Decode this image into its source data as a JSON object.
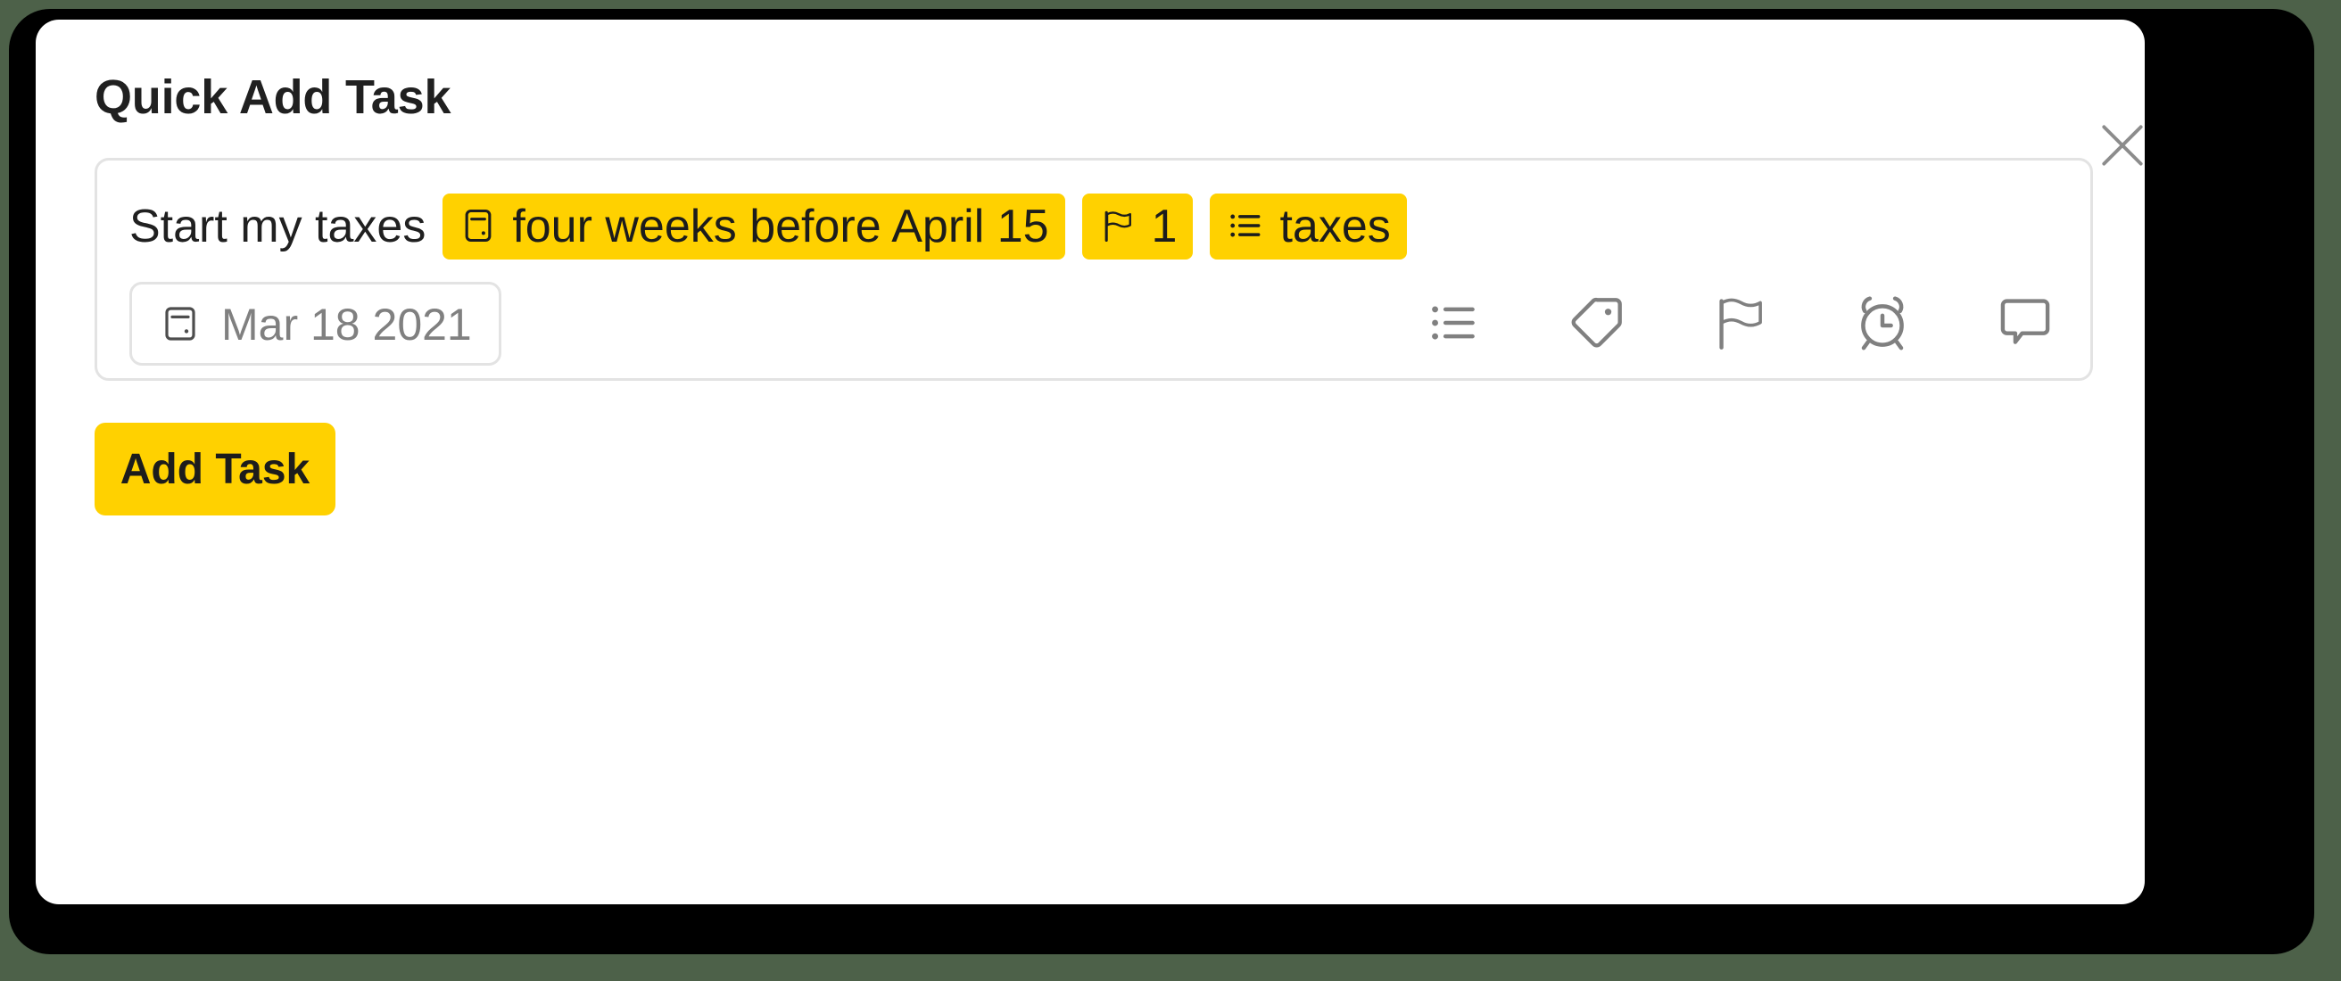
{
  "theme": {
    "page_background": "#4d6149",
    "frame_color": "#000000",
    "card_background": "#ffffff",
    "accent_yellow": "#ffd100",
    "text_primary": "#202020",
    "text_muted": "#808080",
    "border_light": "#e3e3e3",
    "icon_gray": "#808080"
  },
  "dialog": {
    "title": "Quick Add Task",
    "close_icon": "close-icon",
    "close_label": "Close"
  },
  "composer": {
    "task_text": "Start my taxes",
    "chips": [
      {
        "icon": "calendar-icon",
        "label": "four weeks before April 15",
        "type": "due-date"
      },
      {
        "icon": "flag-icon",
        "label": "1",
        "type": "priority"
      },
      {
        "icon": "list-icon",
        "label": "taxes",
        "type": "project"
      }
    ],
    "date_pill": {
      "icon": "calendar-icon",
      "value": "Mar 18 2021"
    },
    "tool_icons": [
      {
        "name": "list-icon",
        "label": "Project"
      },
      {
        "name": "tag-icon",
        "label": "Labels"
      },
      {
        "name": "flag-icon",
        "label": "Priority"
      },
      {
        "name": "alarm-clock-icon",
        "label": "Reminder"
      },
      {
        "name": "comment-icon",
        "label": "Comment"
      }
    ]
  },
  "actions": {
    "add_task_label": "Add Task"
  }
}
